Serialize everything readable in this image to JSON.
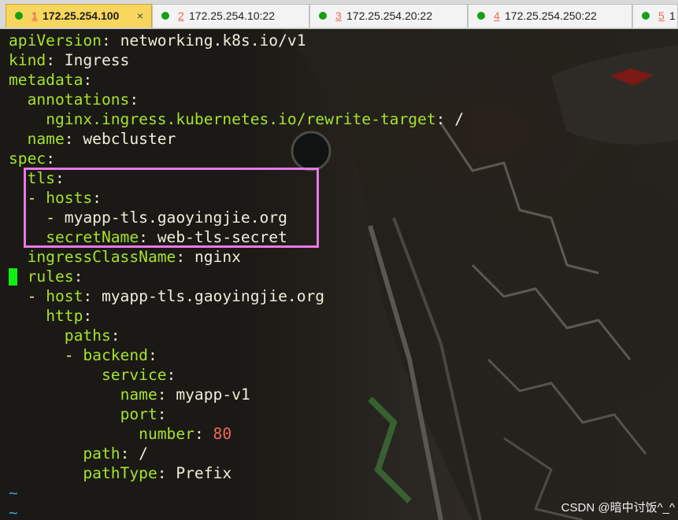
{
  "tabs": [
    {
      "number": "1",
      "host": "172.25.254.100",
      "close": "×",
      "active": true
    },
    {
      "number": "2",
      "host": "172.25.254.10:22",
      "active": false
    },
    {
      "number": "3",
      "host": "172.25.254.20:22",
      "active": false
    },
    {
      "number": "4",
      "host": "172.25.254.250:22",
      "active": false
    },
    {
      "number": "5",
      "host": "1",
      "active": false
    }
  ],
  "editor": {
    "lines": [
      {
        "indent": "",
        "dash": "",
        "key": "apiVersion",
        "value": "networking.k8s.io/v1"
      },
      {
        "indent": "",
        "dash": "",
        "key": "kind",
        "value": "Ingress"
      },
      {
        "indent": "",
        "dash": "",
        "key": "metadata",
        "value": ""
      },
      {
        "indent": "  ",
        "dash": "",
        "key": "annotations",
        "value": ""
      },
      {
        "indent": "    ",
        "dash": "",
        "key": "nginx.ingress.kubernetes.io/rewrite-target",
        "value": "/"
      },
      {
        "indent": "  ",
        "dash": "",
        "key": "name",
        "value": "webcluster"
      },
      {
        "indent": "",
        "dash": "",
        "key": "spec",
        "value": ""
      },
      {
        "indent": "  ",
        "dash": "",
        "key": "tls",
        "value": ""
      },
      {
        "indent": "  ",
        "dash": "- ",
        "key": "hosts",
        "value": ""
      },
      {
        "indent": "    ",
        "dash": "- ",
        "key": "",
        "value": "myapp-tls.gaoyingjie.org"
      },
      {
        "indent": "    ",
        "dash": "",
        "key": "secretName",
        "value": "web-tls-secret"
      },
      {
        "indent": "  ",
        "dash": "",
        "key": "ingressClassName",
        "value": "nginx"
      },
      {
        "indent": "  ",
        "dash": "",
        "key": "rules",
        "value": ""
      },
      {
        "indent": "  ",
        "dash": "- ",
        "key": "host",
        "value": "myapp-tls.gaoyingjie.org"
      },
      {
        "indent": "    ",
        "dash": "",
        "key": "http",
        "value": ""
      },
      {
        "indent": "      ",
        "dash": "",
        "key": "paths",
        "value": ""
      },
      {
        "indent": "      ",
        "dash": "- ",
        "key": "backend",
        "value": ""
      },
      {
        "indent": "          ",
        "dash": "",
        "key": "service",
        "value": ""
      },
      {
        "indent": "            ",
        "dash": "",
        "key": "name",
        "value": "myapp-v1"
      },
      {
        "indent": "            ",
        "dash": "",
        "key": "port",
        "value": ""
      },
      {
        "indent": "              ",
        "dash": "",
        "key": "number",
        "value": "80",
        "numeric": true
      },
      {
        "indent": "        ",
        "dash": "",
        "key": "path",
        "value": "/"
      },
      {
        "indent": "        ",
        "dash": "",
        "key": "pathType",
        "value": "Prefix"
      }
    ],
    "tilde_lines": [
      "~",
      "~"
    ]
  },
  "watermark": "CSDN @暗中讨饭^_^",
  "colors": {
    "active_tab": "#f7d65d",
    "key": "#a6e22e",
    "number": "#f0665a",
    "dash": "#f2ec88",
    "tilde": "#3d9bd6",
    "cursor": "#11ee11",
    "highlight_box": "#e879e6",
    "connected_dot": "#16a016"
  }
}
